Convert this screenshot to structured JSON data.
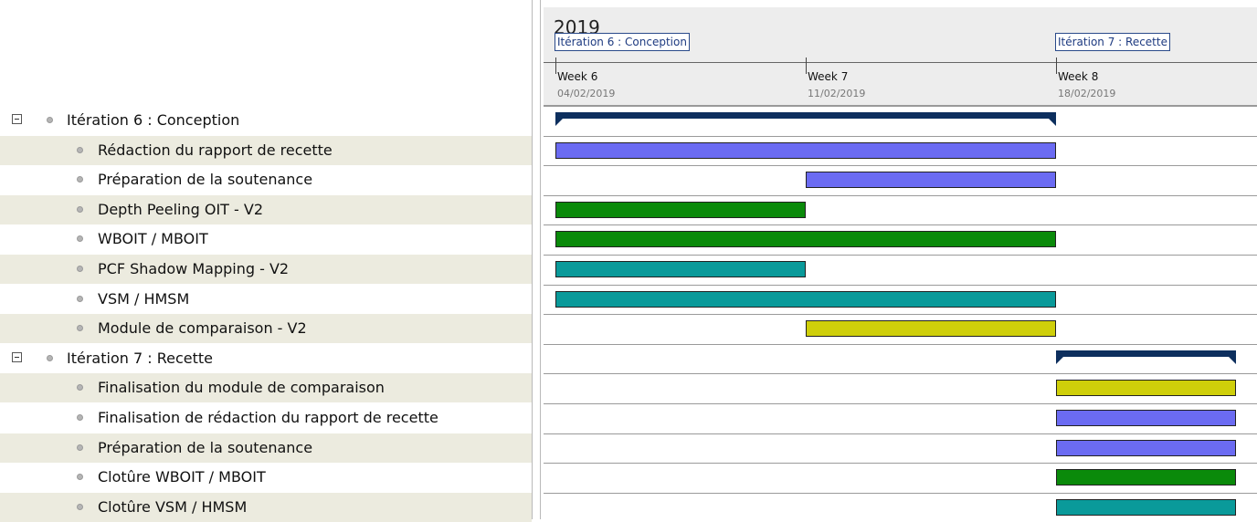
{
  "tree": {
    "rows": [
      {
        "label": "Itération 6 : Conception",
        "group": true
      },
      {
        "label": "Rédaction du rapport de recette",
        "group": false
      },
      {
        "label": "Préparation de la soutenance",
        "group": false
      },
      {
        "label": "Depth Peeling OIT - V2",
        "group": false
      },
      {
        "label": "WBOIT / MBOIT",
        "group": false
      },
      {
        "label": "PCF Shadow Mapping - V2",
        "group": false
      },
      {
        "label": "VSM / HMSM",
        "group": false
      },
      {
        "label": "Module de comparaison - V2",
        "group": false
      },
      {
        "label": "Itération 7 : Recette",
        "group": true
      },
      {
        "label": "Finalisation du module de comparaison",
        "group": false
      },
      {
        "label": "Finalisation de rédaction du rapport de recette",
        "group": false
      },
      {
        "label": "Préparation de la soutenance",
        "group": false
      },
      {
        "label": "Clotûre WBOIT / MBOIT",
        "group": false
      },
      {
        "label": "Clotûre VSM / HMSM",
        "group": false
      }
    ]
  },
  "timeline": {
    "year": "2019",
    "iteration_labels": [
      "Itération 6 : Conception",
      "Itération 7 : Recette"
    ],
    "weeks": [
      {
        "name": "Week 6",
        "date": "04/02/2019"
      },
      {
        "name": "Week 7",
        "date": "11/02/2019"
      },
      {
        "name": "Week 8",
        "date": "18/02/2019"
      }
    ]
  },
  "colors": {
    "summary": "#0d2f5e",
    "purple": "#6b6bf2",
    "green": "#0a8a0a",
    "teal": "#0a9a9a",
    "yellow": "#cfcf0a"
  },
  "tasks": [
    {
      "row": 0,
      "kind": "summary",
      "start": 0,
      "end": 2
    },
    {
      "row": 1,
      "kind": "bar",
      "color": "purple",
      "start": 0,
      "end": 2
    },
    {
      "row": 2,
      "kind": "bar",
      "color": "purple",
      "start": 1,
      "end": 2
    },
    {
      "row": 3,
      "kind": "bar",
      "color": "green",
      "start": 0,
      "end": 1
    },
    {
      "row": 4,
      "kind": "bar",
      "color": "green",
      "start": 0,
      "end": 2
    },
    {
      "row": 5,
      "kind": "bar",
      "color": "teal",
      "start": 0,
      "end": 1
    },
    {
      "row": 6,
      "kind": "bar",
      "color": "teal",
      "start": 0,
      "end": 2
    },
    {
      "row": 7,
      "kind": "bar",
      "color": "yellow",
      "start": 1,
      "end": 2
    },
    {
      "row": 8,
      "kind": "summary",
      "start": 2,
      "end": 2.72
    },
    {
      "row": 9,
      "kind": "bar",
      "color": "yellow",
      "start": 2,
      "end": 2.72
    },
    {
      "row": 10,
      "kind": "bar",
      "color": "purple",
      "start": 2,
      "end": 2.72
    },
    {
      "row": 11,
      "kind": "bar",
      "color": "purple",
      "start": 2,
      "end": 2.72
    },
    {
      "row": 12,
      "kind": "bar",
      "color": "green",
      "start": 2,
      "end": 2.72
    },
    {
      "row": 13,
      "kind": "bar",
      "color": "teal",
      "start": 2,
      "end": 2.72
    }
  ]
}
